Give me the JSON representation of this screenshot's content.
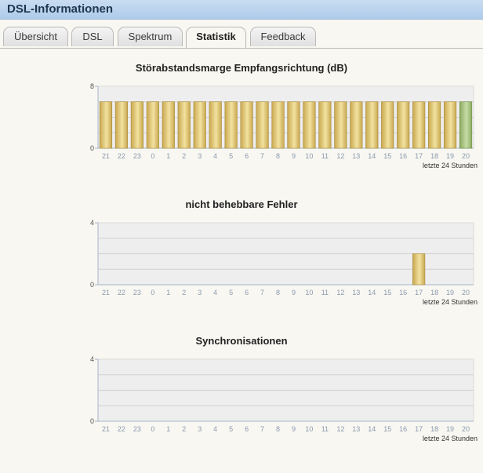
{
  "window": {
    "title": "DSL-Informationen"
  },
  "tabs": [
    {
      "label": "Übersicht"
    },
    {
      "label": "DSL"
    },
    {
      "label": "Spektrum"
    },
    {
      "label": "Statistik",
      "active": true
    },
    {
      "label": "Feedback"
    }
  ],
  "colors": {
    "bar_gold_start": "#c9a84f",
    "bar_gold_mid": "#f2e2a0",
    "bar_green_start": "#8cab5f",
    "bar_green_mid": "#c7dca7",
    "plot_bg": "#eeeeee",
    "axis": "#a7b6cc"
  },
  "chart_data": [
    {
      "type": "bar",
      "title": "Störabstandsmarge Empfangsrichtung (dB)",
      "categories": [
        "21",
        "22",
        "23",
        "0",
        "1",
        "2",
        "3",
        "4",
        "5",
        "6",
        "7",
        "8",
        "9",
        "10",
        "11",
        "12",
        "13",
        "14",
        "15",
        "16",
        "17",
        "18",
        "19",
        "20"
      ],
      "values": [
        6,
        6,
        6,
        6,
        6,
        6,
        6,
        6,
        6,
        6,
        6,
        6,
        6,
        6,
        6,
        6,
        6,
        6,
        6,
        6,
        6,
        6,
        6,
        6
      ],
      "ylim": [
        0,
        8
      ],
      "yticks": [
        "0",
        "8"
      ],
      "xnote": "letzte 24 Stunden",
      "highlight_last": true,
      "grid": true
    },
    {
      "type": "bar",
      "title": "nicht behebbare Fehler",
      "categories": [
        "21",
        "22",
        "23",
        "0",
        "1",
        "2",
        "3",
        "4",
        "5",
        "6",
        "7",
        "8",
        "9",
        "10",
        "11",
        "12",
        "13",
        "14",
        "15",
        "16",
        "17",
        "18",
        "19",
        "20"
      ],
      "values": [
        0,
        0,
        0,
        0,
        0,
        0,
        0,
        0,
        0,
        0,
        0,
        0,
        0,
        0,
        0,
        0,
        0,
        0,
        0,
        0,
        2,
        0,
        0,
        0
      ],
      "ylim": [
        0,
        4
      ],
      "yticks": [
        "0",
        "4"
      ],
      "xnote": "letzte 24 Stunden",
      "highlight_last": false,
      "grid": true
    },
    {
      "type": "bar",
      "title": "Synchronisationen",
      "categories": [
        "21",
        "22",
        "23",
        "0",
        "1",
        "2",
        "3",
        "4",
        "5",
        "6",
        "7",
        "8",
        "9",
        "10",
        "11",
        "12",
        "13",
        "14",
        "15",
        "16",
        "17",
        "18",
        "19",
        "20"
      ],
      "values": [
        0,
        0,
        0,
        0,
        0,
        0,
        0,
        0,
        0,
        0,
        0,
        0,
        0,
        0,
        0,
        0,
        0,
        0,
        0,
        0,
        0,
        0,
        0,
        0
      ],
      "ylim": [
        0,
        4
      ],
      "yticks": [
        "0",
        "4"
      ],
      "xnote": "letzte 24 Stunden",
      "highlight_last": false,
      "grid": true
    }
  ]
}
